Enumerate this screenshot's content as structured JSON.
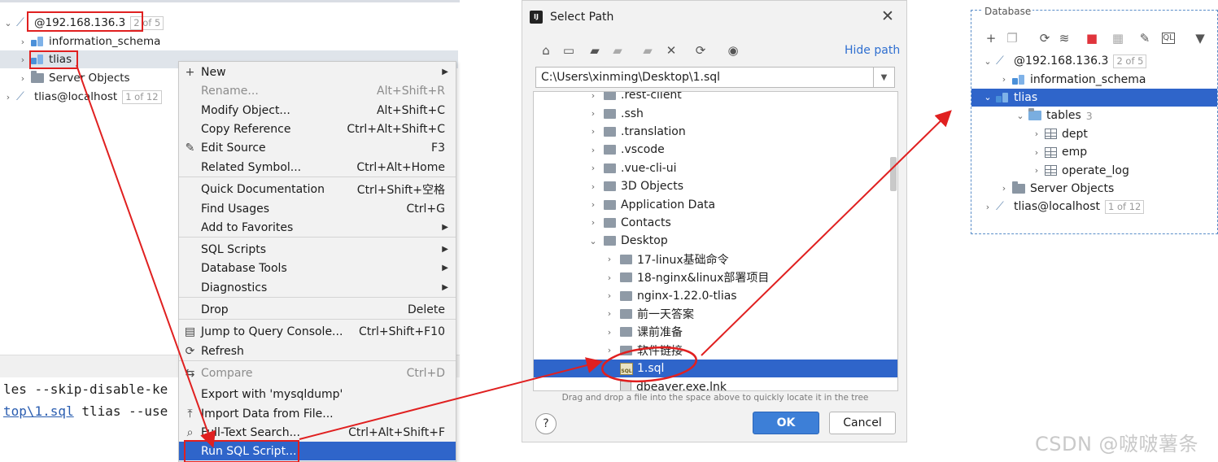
{
  "left_tree": {
    "items": [
      {
        "label": "@192.168.136.3",
        "badge": "2 of 5"
      },
      {
        "label": "information_schema"
      },
      {
        "label": "tlias"
      },
      {
        "label": "Server Objects"
      },
      {
        "label": "tlias@localhost",
        "badge": "1 of 12"
      }
    ]
  },
  "console": {
    "line1": "les --skip-disable-ke",
    "line2_link": "top\\1.sql",
    "line2_rest": " tlias --use"
  },
  "context_menu": {
    "items": [
      {
        "label": "New",
        "shortcut": "",
        "icon": "plus-icon",
        "submenu": true
      },
      {
        "label": "Rename...",
        "shortcut": "Alt+Shift+R",
        "disabled": true
      },
      {
        "label": "Modify Object...",
        "shortcut": "Alt+Shift+C"
      },
      {
        "label": "Copy Reference",
        "shortcut": "Ctrl+Alt+Shift+C"
      },
      {
        "label": "Edit Source",
        "shortcut": "F3",
        "icon": "pencil-icon"
      },
      {
        "label": "Related Symbol...",
        "shortcut": "Ctrl+Alt+Home"
      },
      {
        "label": "Quick Documentation",
        "shortcut": "Ctrl+Shift+空格"
      },
      {
        "label": "Find Usages",
        "shortcut": "Ctrl+G"
      },
      {
        "label": "Add to Favorites",
        "shortcut": "",
        "submenu": true
      },
      {
        "label": "SQL Scripts",
        "shortcut": "",
        "submenu": true
      },
      {
        "label": "Database Tools",
        "shortcut": "",
        "submenu": true
      },
      {
        "label": "Diagnostics",
        "shortcut": "",
        "submenu": true
      },
      {
        "label": "Drop",
        "shortcut": "Delete"
      },
      {
        "label": "Jump to Query Console...",
        "shortcut": "Ctrl+Shift+F10",
        "icon": "console-icon"
      },
      {
        "label": "Refresh",
        "shortcut": "",
        "icon": "refresh-icon"
      },
      {
        "label": "Compare",
        "shortcut": "Ctrl+D",
        "disabled": true,
        "icon": "compare-icon"
      },
      {
        "label": "Export with 'mysqldump'",
        "shortcut": ""
      },
      {
        "label": "Import Data from File...",
        "shortcut": "",
        "icon": "import-icon"
      },
      {
        "label": "Full-Text Search...",
        "shortcut": "Ctrl+Alt+Shift+F",
        "icon": "search-icon"
      },
      {
        "label": "Run SQL Script...",
        "shortcut": "",
        "selected": true
      }
    ]
  },
  "dialog": {
    "title": "Select Path",
    "hide_path_label": "Hide path",
    "path_value": "C:\\Users\\xinming\\Desktop\\1.sql",
    "tree": [
      {
        "label": ".rest-client",
        "level": 1
      },
      {
        "label": ".ssh",
        "level": 1
      },
      {
        "label": ".translation",
        "level": 1
      },
      {
        "label": ".vscode",
        "level": 1
      },
      {
        "label": ".vue-cli-ui",
        "level": 1
      },
      {
        "label": "3D Objects",
        "level": 1
      },
      {
        "label": "Application Data",
        "level": 1
      },
      {
        "label": "Contacts",
        "level": 1
      },
      {
        "label": "Desktop",
        "level": 1,
        "expanded": true
      },
      {
        "label": "17-linux基础命令",
        "level": 2
      },
      {
        "label": "18-nginx&linux部署项目",
        "level": 2
      },
      {
        "label": "nginx-1.22.0-tlias",
        "level": 2
      },
      {
        "label": "前一天答案",
        "level": 2
      },
      {
        "label": "课前准备",
        "level": 2
      },
      {
        "label": "软件链接",
        "level": 2
      },
      {
        "label": "1.sql",
        "level": 2,
        "file": "sql",
        "selected": true
      },
      {
        "label": "dbeaver.exe.lnk",
        "level": 2,
        "file": "lnk"
      }
    ],
    "hint": "Drag and drop a file into the space above to quickly locate it in the tree",
    "help_label": "?",
    "ok_label": "OK",
    "cancel_label": "Cancel"
  },
  "right_panel": {
    "title": "Database",
    "items": [
      {
        "label": "@192.168.136.3",
        "badge": "2 of 5"
      },
      {
        "label": "information_schema"
      },
      {
        "label": "tlias",
        "selected": true
      },
      {
        "label": "tables",
        "count": "3"
      },
      {
        "label": "dept"
      },
      {
        "label": "emp"
      },
      {
        "label": "operate_log"
      },
      {
        "label": "Server Objects"
      },
      {
        "label": "tlias@localhost",
        "badge": "1 of 12"
      }
    ]
  },
  "watermark": "CSDN @啵啵薯条",
  "colors": {
    "selection": "#2f65ca",
    "annotation": "#e02020",
    "ok_button": "#3d7fd7"
  }
}
